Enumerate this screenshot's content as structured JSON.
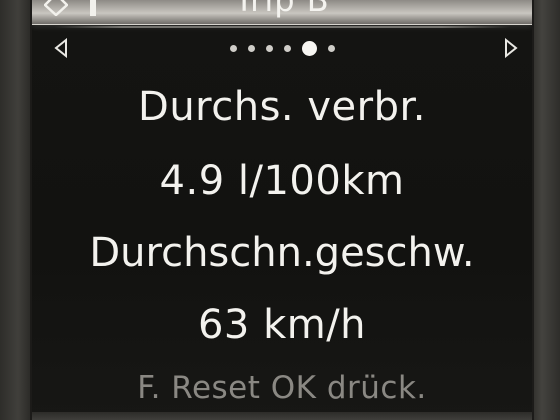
{
  "header": {
    "title": "Trip B",
    "menu_icon": "menu-chevron-icon"
  },
  "navigation": {
    "left_arrow_icon": "triangle-left-icon",
    "right_arrow_icon": "triangle-right-icon",
    "page_count": 6,
    "active_page": 5
  },
  "readouts": {
    "avg_consumption_label": "Durchs. verbr.",
    "avg_consumption_value": "4.9 l/100km",
    "avg_speed_label": "Durchschn.geschw.",
    "avg_speed_value": "63 km/h"
  },
  "footer": {
    "hint": "F. Reset OK drück."
  },
  "colors": {
    "text": "#f3f2ee",
    "dim_text": "#8a8883",
    "background": "#131311",
    "title_bar": "#c9c6c0"
  }
}
